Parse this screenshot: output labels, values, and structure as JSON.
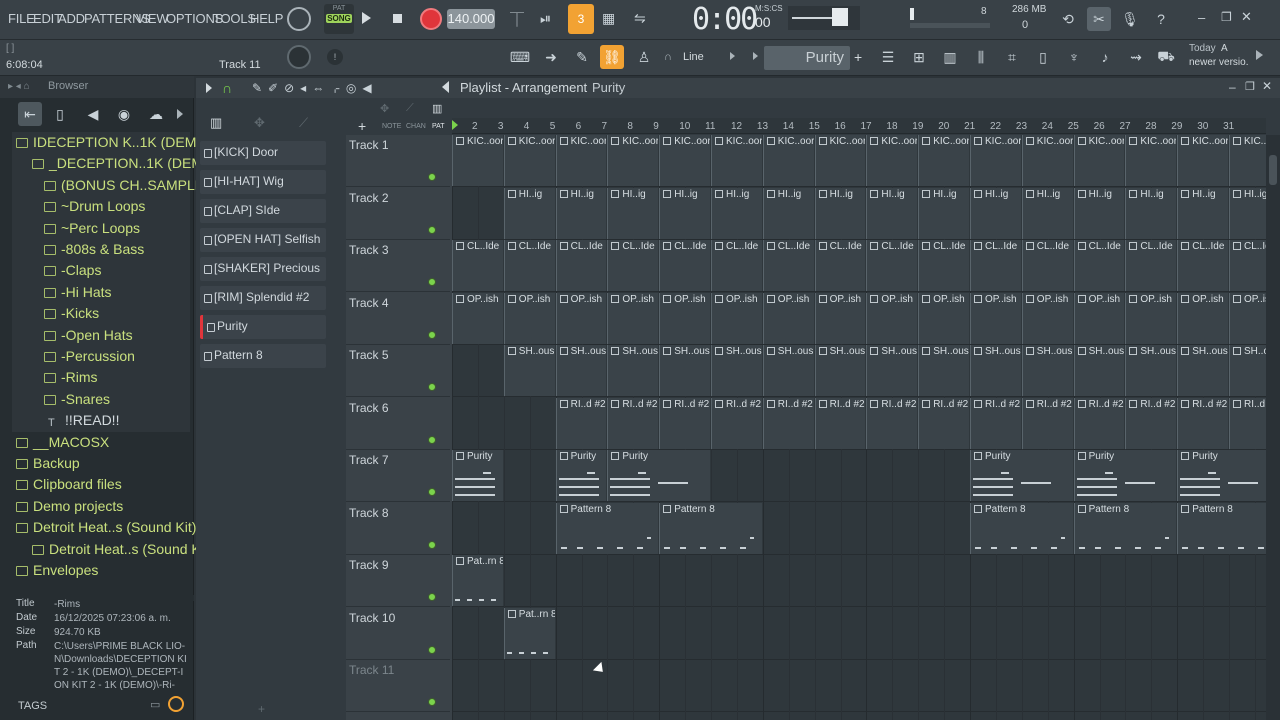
{
  "menu": [
    "FILE",
    "EDIT",
    "ADD",
    "PATTERNS",
    "VIEW",
    "OPTIONS",
    "TOOLS",
    "HELP"
  ],
  "transport": {
    "mode_top": "PAT",
    "mode_bottom": "SONG",
    "tempo": "140.000",
    "time": "0:00",
    "time_small": "00",
    "time_unit": "M:S:CS"
  },
  "cpu": {
    "ram": "286 MB",
    "value1": "8",
    "value2": "0"
  },
  "hint": {
    "pos": "6:08:04",
    "track": "Track 11",
    "bracket": "[ ]"
  },
  "snap": "Line",
  "pattern_selector": "Purity",
  "news": {
    "line1": "Today",
    "line1b": "A",
    "line2": "newer versio."
  },
  "browser": {
    "title": "Browser",
    "items": [
      {
        "label": "IDECEPTION K..1K (DEMO)",
        "indent": 0
      },
      {
        "label": "_DECEPTION..1K (DEMO)",
        "indent": 1
      },
      {
        "label": "(BONUS CH..SAMPLES)",
        "indent": 2
      },
      {
        "label": "~Drum Loops",
        "indent": 2
      },
      {
        "label": "~Perc Loops",
        "indent": 2
      },
      {
        "label": "-808s & Bass",
        "indent": 2
      },
      {
        "label": "-Claps",
        "indent": 2
      },
      {
        "label": "-Hi Hats",
        "indent": 2
      },
      {
        "label": "-Kicks",
        "indent": 2
      },
      {
        "label": "-Open Hats",
        "indent": 2
      },
      {
        "label": "-Percussion",
        "indent": 2
      },
      {
        "label": "-Rims",
        "indent": 2
      },
      {
        "label": "-Snares",
        "indent": 2
      },
      {
        "label": "!!READ!!",
        "indent": 3
      },
      {
        "label": "__MACOSX",
        "indent": 0
      },
      {
        "label": "Backup",
        "indent": 0
      },
      {
        "label": "Clipboard files",
        "indent": 0
      },
      {
        "label": "Demo projects",
        "indent": 0
      },
      {
        "label": "Detroit Heat..s (Sound Kit)",
        "indent": 0
      },
      {
        "label": "Detroit Heat..s (Sound Kit)",
        "indent": 1
      },
      {
        "label": "Envelopes",
        "indent": 0
      }
    ]
  },
  "info": {
    "title_k": "Title",
    "title": "-Rims",
    "date_k": "Date",
    "date": "16/12/2025 07:23:06 a. m.",
    "size_k": "Size",
    "size": "924.70 KB",
    "path_k": "Path",
    "path": "C:\\Users\\PRIME BLACK LIO-N\\Downloads\\DECEPTION KIT 2 - 1K (DEMO)\\_DECEPT-ION KIT 2 - 1K (DEMO)\\-Ri-",
    "tags": "TAGS"
  },
  "playlist": {
    "title": "Playlist - Arrangement",
    "pattern": "Purity",
    "tabs": [
      "NOTE",
      "CHAN",
      "PAT"
    ]
  },
  "patterns": [
    "[KICK] Door",
    "[HI-HAT] Wig",
    "[CLAP] SIde",
    "[OPEN HAT] Selfish",
    "[SHAKER] Precious",
    "[RIM] Splendid #2",
    "Purity",
    "Pattern 8"
  ],
  "tracks": [
    "Track 1",
    "Track 2",
    "Track 3",
    "Track 4",
    "Track 5",
    "Track 6",
    "Track 7",
    "Track 8",
    "Track 9",
    "Track 10",
    "Track 11"
  ],
  "ruler": [
    "2",
    "3",
    "4",
    "5",
    "6",
    "7",
    "8",
    "9",
    "10",
    "11",
    "12",
    "13",
    "14",
    "15",
    "16",
    "17",
    "18",
    "19",
    "20",
    "21",
    "22",
    "23",
    "24",
    "25",
    "26",
    "27",
    "28",
    "29",
    "30",
    "31"
  ],
  "clip_labels": {
    "t1": "KIC..oor",
    "t2": "HI..ig",
    "t3": "CL..Ide",
    "t4": "OP..ish",
    "t5": "SH..ous",
    "t6": "RI..d #2",
    "t7": "Purity",
    "t8": "Pattern 8",
    "t9": "Pat..rn 8",
    "t10": "Pat..rn 8"
  },
  "colors": {
    "accent": "#7bd34c",
    "record": "#e0353b",
    "folder": "#c9e07e"
  }
}
